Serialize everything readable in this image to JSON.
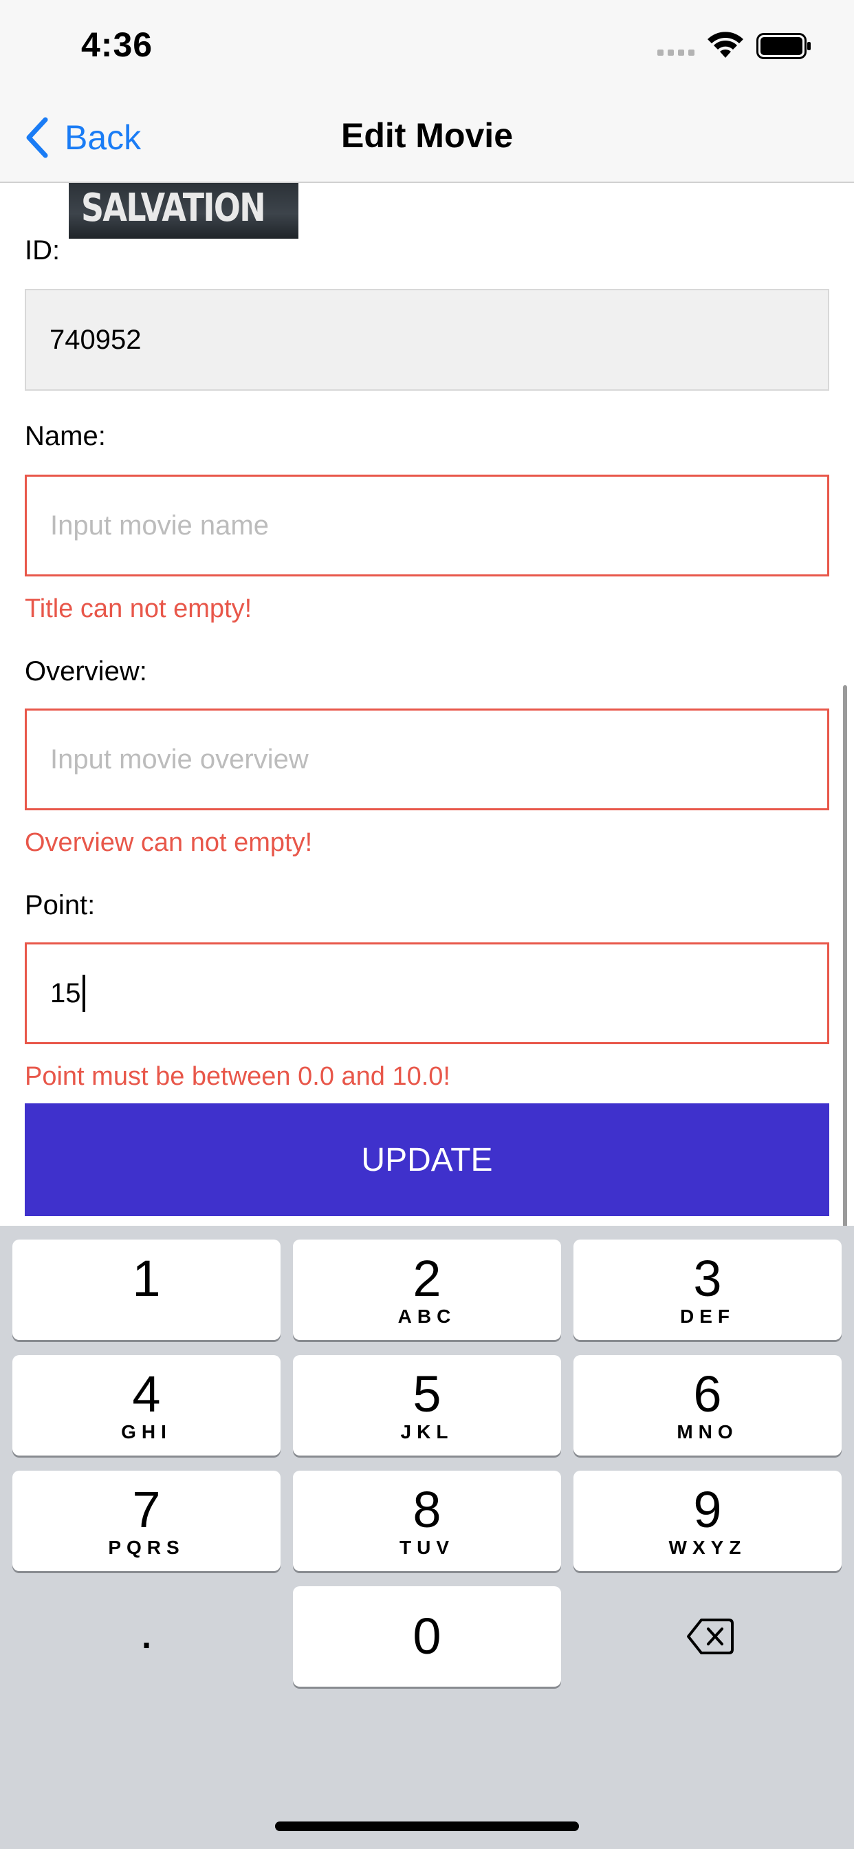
{
  "status_bar": {
    "time": "4:36"
  },
  "nav": {
    "back_label": "Back",
    "title": "Edit Movie"
  },
  "poster": {
    "title_text": "SALVATION"
  },
  "form": {
    "id_label": "ID:",
    "id_value": "740952",
    "name_label": "Name:",
    "name_placeholder": "Input movie name",
    "name_error": "Title can not empty!",
    "overview_label": "Overview:",
    "overview_placeholder": "Input movie overview",
    "overview_error": "Overview can not empty!",
    "point_label": "Point:",
    "point_value": "15",
    "point_error": "Point must be between 0.0 and 10.0!",
    "update_label": "UPDATE"
  },
  "colors": {
    "accent": "#3f31cc",
    "error": "#e8574a",
    "link": "#1a7cf5"
  },
  "keyboard": {
    "keys": [
      {
        "num": "1",
        "letters": ""
      },
      {
        "num": "2",
        "letters": "ABC"
      },
      {
        "num": "3",
        "letters": "DEF"
      },
      {
        "num": "4",
        "letters": "GHI"
      },
      {
        "num": "5",
        "letters": "JKL"
      },
      {
        "num": "6",
        "letters": "MNO"
      },
      {
        "num": "7",
        "letters": "PQRS"
      },
      {
        "num": "8",
        "letters": "TUV"
      },
      {
        "num": "9",
        "letters": "WXYZ"
      },
      {
        "num": ".",
        "letters": ""
      },
      {
        "num": "0",
        "letters": ""
      }
    ],
    "delete_icon": "backspace-icon"
  }
}
